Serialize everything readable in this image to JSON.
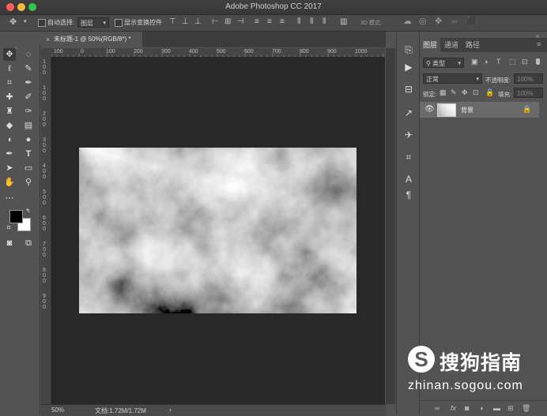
{
  "window": {
    "title": "Adobe Photoshop CC 2017",
    "lights": [
      "#fc605c",
      "#fdbc40",
      "#34c84a"
    ]
  },
  "options_bar": {
    "move_icon": "move-icon",
    "auto_select_label": "自动选择:",
    "auto_select_value": "图层",
    "show_transform_label": "显示变换控件",
    "mode_3d_label": "3D 模式:"
  },
  "document": {
    "tab_label": "未标题-1 @ 50%(RGB/8*) *",
    "close_glyph": "×",
    "ruler_h": [
      "100",
      "0",
      "100",
      "200",
      "300",
      "400",
      "500",
      "600",
      "700",
      "800",
      "900",
      "1000"
    ],
    "ruler_v": [
      "1",
      "0",
      "0",
      "1",
      "0",
      "0",
      "2",
      "0",
      "0",
      "3",
      "0",
      "0",
      "4",
      "0",
      "0",
      "5",
      "0",
      "0",
      "6",
      "0",
      "0",
      "7",
      "0",
      "0",
      "8",
      "0",
      "0",
      "9",
      "0",
      "0"
    ],
    "image": "clouds-render"
  },
  "status": {
    "zoom": "50%",
    "doc_info": "文档:1.72M/1.72M",
    "arrow": "›"
  },
  "colors": {
    "foreground": "#000000",
    "background": "#ffffff"
  },
  "panel": {
    "tabs": [
      "图层",
      "通道",
      "路径"
    ],
    "kind_filter": "类型",
    "blend_mode": "正常",
    "opacity_label": "不透明度:",
    "opacity_value": "100%",
    "lock_label": "锁定:",
    "fill_label": "填充:",
    "fill_value": "100%",
    "layer_name": "背景",
    "footer_fx": "fx"
  },
  "watermark": {
    "logo": "S",
    "name": "搜狗指南",
    "url": "zhinan.sogou.com"
  }
}
